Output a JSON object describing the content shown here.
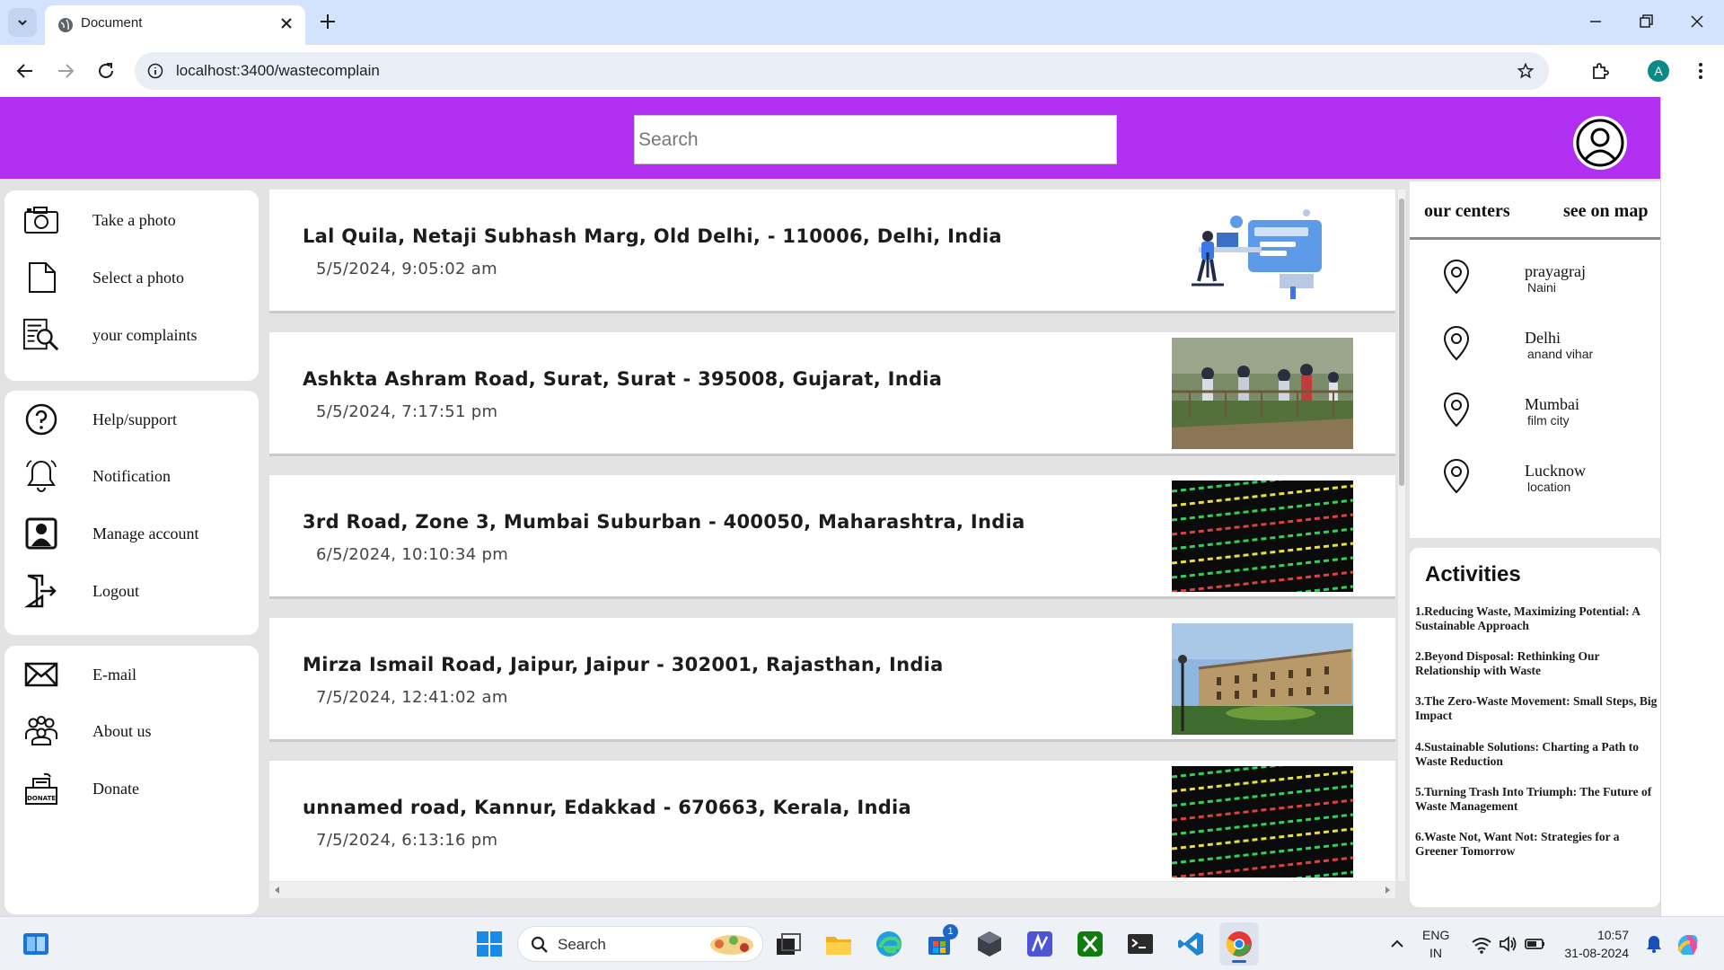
{
  "browser": {
    "tab_title": "Document",
    "url": "localhost:3400/wastecomplain",
    "profile_initial": "A"
  },
  "header": {
    "search_placeholder": "Search"
  },
  "sidebar": {
    "group1": [
      {
        "label": "Take a photo",
        "icon": "camera-icon"
      },
      {
        "label": "Select a photo",
        "icon": "file-icon"
      },
      {
        "label": "your complaints",
        "icon": "complaints-search-icon"
      }
    ],
    "group2": [
      {
        "label": "Help/support",
        "icon": "help-icon"
      },
      {
        "label": "Notification",
        "icon": "bell-icon"
      },
      {
        "label": "Manage account",
        "icon": "account-icon"
      },
      {
        "label": "Logout",
        "icon": "logout-icon"
      }
    ],
    "group3": [
      {
        "label": "E-mail",
        "icon": "mail-icon"
      },
      {
        "label": "About us",
        "icon": "people-icon"
      },
      {
        "label": "Donate",
        "icon": "donate-icon",
        "icon_text": "DONATE"
      }
    ]
  },
  "complaints": [
    {
      "address": "Lal Quila, Netaji Subhash Marg, Old Delhi, - 110006, Delhi, India",
      "date": "5/5/2024, 9:05:02 am",
      "image": "office-illustration"
    },
    {
      "address": "Ashkta Ashram Road, Surat, Surat - 395008, Gujarat, India",
      "date": "5/5/2024, 7:17:51 pm",
      "image": "cleanup-photo"
    },
    {
      "address": "3rd Road, Zone 3, Mumbai Suburban - 400050, Maharashtra, India",
      "date": "6/5/2024, 10:10:34 pm",
      "image": "stock-board-photo"
    },
    {
      "address": "Mirza Ismail Road, Jaipur, Jaipur - 302001, Rajasthan, India",
      "date": "7/5/2024, 12:41:02 am",
      "image": "palace-photo"
    },
    {
      "address": "unnamed road, Kannur, Edakkad - 670663, Kerala, India",
      "date": "7/5/2024, 6:13:16 pm",
      "image": "stock-board-photo"
    }
  ],
  "centers": {
    "tab_left": "our centers",
    "tab_right": "see on map",
    "items": [
      {
        "city": "prayagraj",
        "sub": "Naini"
      },
      {
        "city": "Delhi",
        "sub": "anand vihar"
      },
      {
        "city": "Mumbai",
        "sub": "film city"
      },
      {
        "city": "Lucknow",
        "sub": "location"
      }
    ]
  },
  "activities": {
    "title": "Activities",
    "items": [
      "1.Reducing Waste, Maximizing Potential: A Sustainable Approach",
      "2.Beyond Disposal: Rethinking Our Relationship with Waste",
      "3.The Zero-Waste Movement: Small Steps, Big Impact",
      "4.Sustainable Solutions: Charting a Path to Waste Reduction",
      "5.Turning Trash Into Triumph: The Future of Waste Management",
      "6.Waste Not, Want Not: Strategies for a Greener Tomorrow"
    ]
  },
  "taskbar": {
    "search_label": "Search",
    "store_badge": "1",
    "lang_top": "ENG",
    "lang_bottom": "IN",
    "time": "10:57",
    "date": "31-08-2024"
  },
  "colors": {
    "header_purple": "#b02ff0",
    "page_bg": "#e3e3e3",
    "chrome_tabbar": "#d3e3fd"
  }
}
